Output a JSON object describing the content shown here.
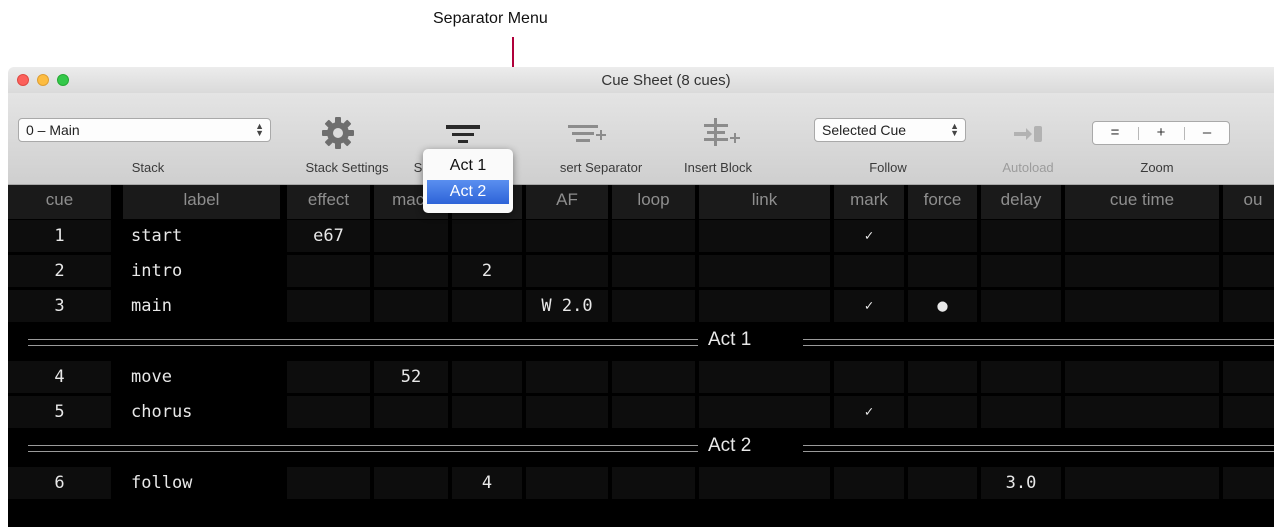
{
  "annotation": "Separator Menu",
  "window": {
    "title": "Cue Sheet (8 cues)"
  },
  "toolbar": {
    "stack_value": "0 – Main",
    "stack_label": "Stack",
    "stack_settings_label": "Stack Settings",
    "insert_separator_label": "sert Separator",
    "insert_block_label": "Insert Block",
    "follow_value": "Selected Cue",
    "follow_label": "Follow",
    "autoload_label": "Autoload",
    "zoom_label": "Zoom",
    "zoom_equal": "=",
    "zoom_plus": "+",
    "zoom_minus": "–",
    "partial_label": "S"
  },
  "separator_menu": {
    "items": [
      "Act 1",
      "Act 2"
    ],
    "selected": "Act 2"
  },
  "columns": [
    "cue",
    "label",
    "effect",
    "macr",
    "",
    "AF",
    "loop",
    "link",
    "mark",
    "force",
    "delay",
    "cue time",
    "ou"
  ],
  "rows": [
    {
      "cue": "1",
      "label": "start",
      "effect": "e67",
      "macro": "",
      "block": "",
      "af": "",
      "mark": "✓",
      "force": "",
      "delay": ""
    },
    {
      "cue": "2",
      "label": "intro",
      "effect": "",
      "macro": "",
      "block": "2",
      "af": "",
      "mark": "",
      "force": "",
      "delay": ""
    },
    {
      "cue": "3",
      "label": "main",
      "effect": "",
      "macro": "",
      "block": "",
      "af": "W 2.0",
      "mark": "✓",
      "force": "●",
      "delay": ""
    },
    {
      "separator": "Act 1"
    },
    {
      "cue": "4",
      "label": "move",
      "effect": "",
      "macro": "52",
      "block": "",
      "af": "",
      "mark": "",
      "force": "",
      "delay": ""
    },
    {
      "cue": "5",
      "label": "chorus",
      "effect": "",
      "macro": "",
      "block": "",
      "af": "",
      "mark": "✓",
      "force": "",
      "delay": ""
    },
    {
      "separator": "Act 2"
    },
    {
      "cue": "6",
      "label": "follow",
      "effect": "",
      "macro": "",
      "block": "4",
      "af": "",
      "mark": "",
      "force": "",
      "delay": "3.0"
    }
  ],
  "colors": {
    "selection": "#2d63d8",
    "annotation_line": "#b0003a",
    "grid_bg": "#000000"
  },
  "icons": [
    "gear-icon",
    "separator-menu-icon",
    "insert-separator-icon",
    "insert-block-icon",
    "autoload-icon"
  ]
}
